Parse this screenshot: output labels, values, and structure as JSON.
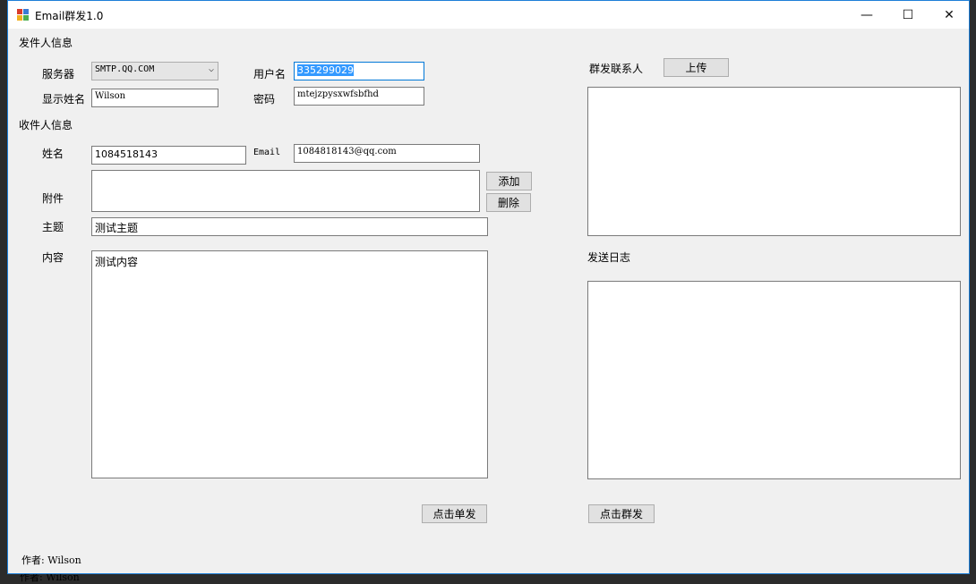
{
  "behind_text": "作者: Wilson",
  "window": {
    "title": "Email群发1.0",
    "minimize": "—",
    "maximize": "☐",
    "close": "✕"
  },
  "sender": {
    "section_label": "发件人信息",
    "server_label": "服务器",
    "server_value": "SMTP.QQ.COM",
    "display_name_label": "显示姓名",
    "display_name_value": "Wilson",
    "username_label": "用户名",
    "username_value": "335299029",
    "password_label": "密码",
    "password_value": "mtejzpysxwfsbfhd"
  },
  "recipient": {
    "section_label": "收件人信息",
    "name_label": "姓名",
    "name_value": "1084518143",
    "email_label": "Email",
    "email_value": "1084818143@qq.com",
    "attachment_label": "附件",
    "attachment_value": "",
    "add_button": "添加",
    "delete_button": "删除",
    "subject_label": "主题",
    "subject_value": "测试主题",
    "content_label": "内容",
    "content_value": "测试内容",
    "send_single_button": "点击单发"
  },
  "group": {
    "contacts_label": "群发联系人",
    "upload_button": "上传",
    "contacts_value": "",
    "log_label": "发送日志",
    "log_value": "",
    "send_group_button": "点击群发"
  },
  "footer": {
    "author": "作者: Wilson"
  }
}
